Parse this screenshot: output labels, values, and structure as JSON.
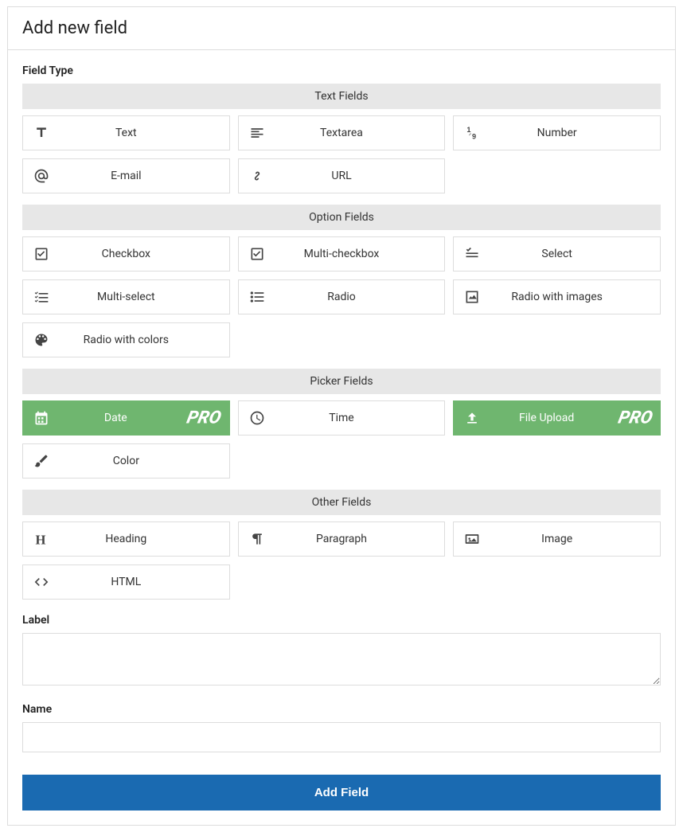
{
  "title": "Add new field",
  "field_type_label": "Field Type",
  "groups": {
    "text": {
      "header": "Text Fields",
      "items": [
        {
          "label": "Text",
          "icon": "font",
          "pro": false
        },
        {
          "label": "Textarea",
          "icon": "align-left",
          "pro": false
        },
        {
          "label": "Number",
          "icon": "one-nine",
          "pro": false
        },
        {
          "label": "E-mail",
          "icon": "at",
          "pro": false
        },
        {
          "label": "URL",
          "icon": "link",
          "pro": false
        }
      ]
    },
    "option": {
      "header": "Option Fields",
      "items": [
        {
          "label": "Checkbox",
          "icon": "checkbox",
          "pro": false
        },
        {
          "label": "Multi-checkbox",
          "icon": "checkbox",
          "pro": false
        },
        {
          "label": "Select",
          "icon": "select-list",
          "pro": false
        },
        {
          "label": "Multi-select",
          "icon": "list-check",
          "pro": false
        },
        {
          "label": "Radio",
          "icon": "list-bullet",
          "pro": false
        },
        {
          "label": "Radio with images",
          "icon": "image-square",
          "pro": false
        },
        {
          "label": "Radio with colors",
          "icon": "palette",
          "pro": false
        }
      ]
    },
    "picker": {
      "header": "Picker Fields",
      "items": [
        {
          "label": "Date",
          "icon": "calendar",
          "pro": true
        },
        {
          "label": "Time",
          "icon": "clock",
          "pro": false
        },
        {
          "label": "File Upload",
          "icon": "upload",
          "pro": true
        },
        {
          "label": "Color",
          "icon": "brush",
          "pro": false
        }
      ]
    },
    "other": {
      "header": "Other Fields",
      "items": [
        {
          "label": "Heading",
          "icon": "heading",
          "pro": false
        },
        {
          "label": "Paragraph",
          "icon": "paragraph",
          "pro": false
        },
        {
          "label": "Image",
          "icon": "image",
          "pro": false
        },
        {
          "label": "HTML",
          "icon": "code",
          "pro": false
        }
      ]
    }
  },
  "pro_badge": "PRO",
  "label_label": "Label",
  "name_label": "Name",
  "label_value": "",
  "name_value": "",
  "submit_label": "Add Field"
}
